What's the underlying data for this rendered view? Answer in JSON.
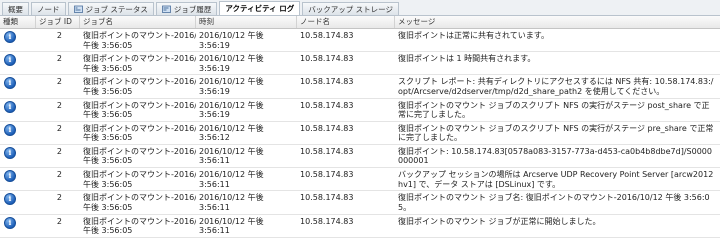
{
  "tabs": [
    {
      "label": "概要",
      "icon": "",
      "active": false
    },
    {
      "label": "ノード",
      "icon": "",
      "active": false
    },
    {
      "label": "ジョブ ステータス",
      "icon": "job-status-icon",
      "active": false
    },
    {
      "label": "ジョブ履歴",
      "icon": "job-history-icon",
      "active": false
    },
    {
      "label": "アクティビティ ログ",
      "icon": "",
      "active": true
    },
    {
      "label": "バックアップ ストレージ",
      "icon": "",
      "active": false
    }
  ],
  "columns": {
    "type": "種類",
    "job_id": "ジョブ ID",
    "job_name": "ジョブ名",
    "time": "時刻",
    "node": "ノード名",
    "message": "メッセージ"
  },
  "rows": [
    {
      "icon": "info-icon",
      "job_id": "2",
      "job_name_1": "復旧ポイントのマウント-2016/10/12",
      "job_name_2": "午後 3:56:05",
      "time": "2016/10/12 午後 3:56:19",
      "node": "10.58.174.83",
      "message": "復旧ポイントは正常に共有されています。"
    },
    {
      "icon": "info-icon",
      "job_id": "2",
      "job_name_1": "復旧ポイントのマウント-2016/10/12",
      "job_name_2": "午後 3:56:05",
      "time": "2016/10/12 午後 3:56:19",
      "node": "10.58.174.83",
      "message": "復旧ポイントは 1 時間共有されます。"
    },
    {
      "icon": "info-icon",
      "job_id": "2",
      "job_name_1": "復旧ポイントのマウント-2016/10/12",
      "job_name_2": "午後 3:56:05",
      "time": "2016/10/12 午後 3:56:19",
      "node": "10.58.174.83",
      "message": "スクリプト レポート: 共有ディレクトリにアクセスするには NFS 共有: 10.58.174.83:/opt/Arcserve/d2dserver/tmp/d2d_share_path2 を使用してください。"
    },
    {
      "icon": "info-icon",
      "job_id": "2",
      "job_name_1": "復旧ポイントのマウント-2016/10/12",
      "job_name_2": "午後 3:56:05",
      "time": "2016/10/12 午後 3:56:19",
      "node": "10.58.174.83",
      "message": "復旧ポイントのマウント ジョブのスクリプト NFS の実行がステージ post_share で正常に完了しました。"
    },
    {
      "icon": "info-icon",
      "job_id": "2",
      "job_name_1": "復旧ポイントのマウント-2016/10/12",
      "job_name_2": "午後 3:56:05",
      "time": "2016/10/12 午後 3:56:12",
      "node": "10.58.174.83",
      "message": "復旧ポイントのマウント ジョブのスクリプト NFS の実行がステージ pre_share で正常に完了しました。"
    },
    {
      "icon": "info-icon",
      "job_id": "2",
      "job_name_1": "復旧ポイントのマウント-2016/10/12",
      "job_name_2": "午後 3:56:05",
      "time": "2016/10/12 午後 3:56:11",
      "node": "10.58.174.83",
      "message": "復旧ポイント: 10.58.174.83[0578a083-3157-773a-d453-ca0b4b8dbe7d]/S0000000001"
    },
    {
      "icon": "info-icon",
      "job_id": "2",
      "job_name_1": "復旧ポイントのマウント-2016/10/12",
      "job_name_2": "午後 3:56:05",
      "time": "2016/10/12 午後 3:56:11",
      "node": "10.58.174.83",
      "message": "バックアップ セッションの場所は Arcserve UDP Recovery Point Server [arcw2012hv1] で、データ ストアは [DSLinux] です。"
    },
    {
      "icon": "info-icon",
      "job_id": "2",
      "job_name_1": "復旧ポイントのマウント-2016/10/12",
      "job_name_2": "午後 3:56:05",
      "time": "2016/10/12 午後 3:56:11",
      "node": "10.58.174.83",
      "message": "復旧ポイントのマウント ジョブ名: 復旧ポイントのマウント-2016/10/12 午後 3:56:05。"
    },
    {
      "icon": "info-icon",
      "job_id": "2",
      "job_name_1": "復旧ポイントのマウント-2016/10/12",
      "job_name_2": "午後 3:56:05",
      "time": "2016/10/12 午後 3:56:11",
      "node": "10.58.174.83",
      "message": "復旧ポイントのマウント ジョブが正常に開始しました。"
    }
  ]
}
